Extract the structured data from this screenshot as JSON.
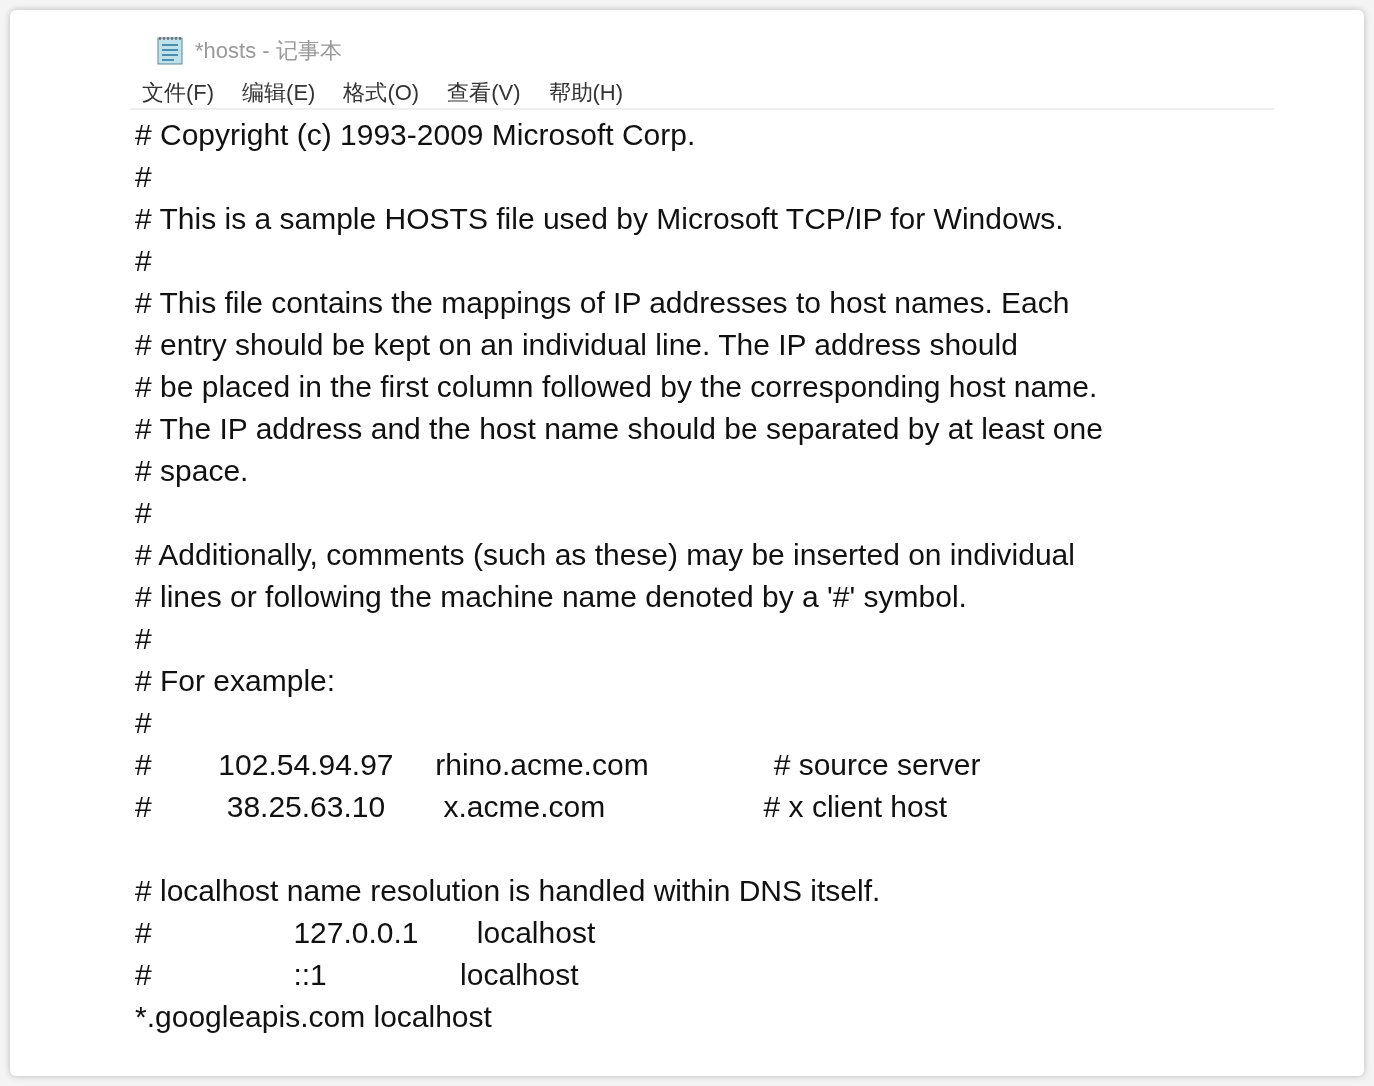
{
  "window": {
    "title": "*hosts - 记事本"
  },
  "menu": [
    "文件(F)",
    "编辑(E)",
    "格式(O)",
    "查看(V)",
    "帮助(H)"
  ],
  "editor": {
    "blocks": [
      [
        "# Copyright (c) 1993-2009 Microsoft Corp.",
        "#",
        "# This is a sample HOSTS file used by Microsoft TCP/IP for Windows.",
        "#",
        "# This file contains the mappings of IP addresses to host names. Each",
        "# entry should be kept on an individual line. The IP address should",
        "# be placed in the first column followed by the corresponding host name.",
        "# The IP address and the host name should be separated by at least one",
        "# space.",
        "#",
        "# Additionally, comments (such as these) may be inserted on individual",
        "# lines or following the machine name denoted by a '#' symbol.",
        "#",
        "# For example:",
        "#",
        "#        102.54.94.97     rhino.acme.com               # source server",
        "#         38.25.63.10       x.acme.com                   # x client host"
      ],
      [
        "# localhost name resolution is handled within DNS itself.",
        "#                 127.0.0.1       localhost",
        "#                 ::1                localhost",
        "*.googleapis.com localhost"
      ]
    ]
  }
}
